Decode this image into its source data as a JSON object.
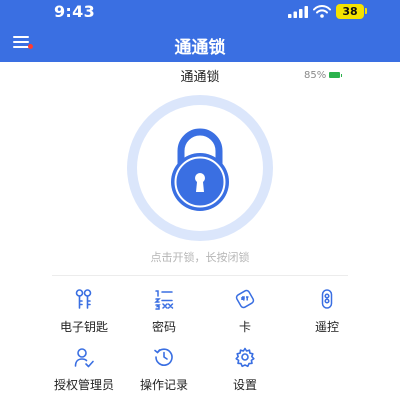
{
  "status_bar": {
    "time": "9:43",
    "battery_level": "38"
  },
  "header": {
    "title": "通通锁"
  },
  "device": {
    "name": "通通锁",
    "battery": "85%"
  },
  "lock": {
    "hint": "点击开锁，长按闭锁"
  },
  "features": [
    {
      "label": "电子钥匙",
      "icon": "key-icon"
    },
    {
      "label": "密码",
      "icon": "keypad-icon"
    },
    {
      "label": "卡",
      "icon": "card-icon"
    },
    {
      "label": "遥控",
      "icon": "remote-icon"
    },
    {
      "label": "授权管理员",
      "icon": "admin-icon"
    },
    {
      "label": "操作记录",
      "icon": "history-icon"
    },
    {
      "label": "设置",
      "icon": "gear-icon"
    }
  ],
  "colors": {
    "primary": "#3a6fe2",
    "battery_pill": "#f4e200",
    "battery_green": "#2bb24c",
    "notification_dot": "#ff3b30"
  }
}
